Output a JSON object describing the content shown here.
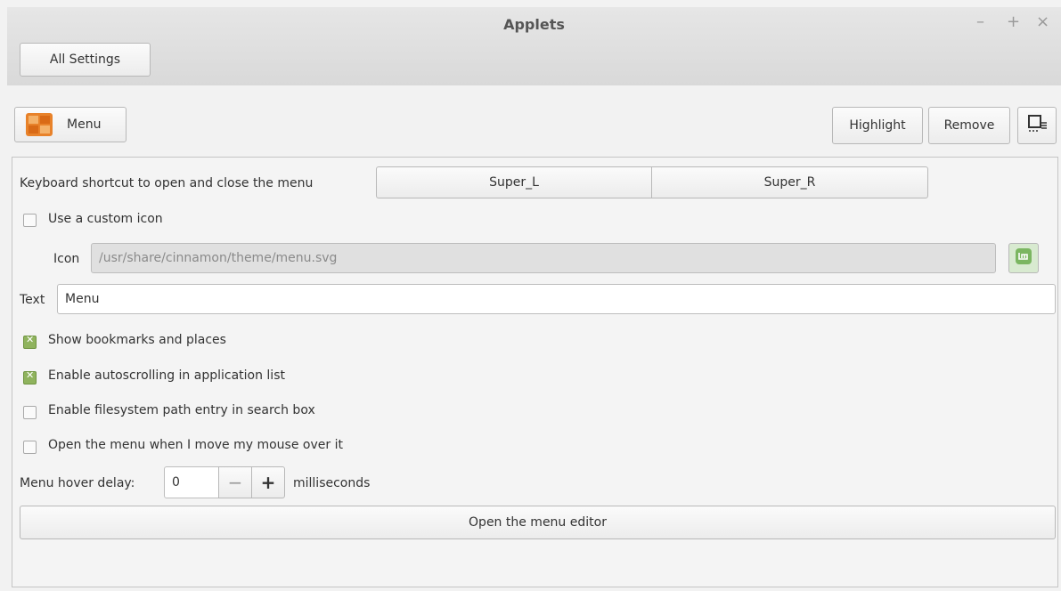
{
  "window": {
    "title": "Applets",
    "controls": [
      "–",
      "+",
      "×"
    ]
  },
  "toolbar": {
    "all_settings_label": "All Settings"
  },
  "applet_bar": {
    "applet_name": "Menu",
    "highlight_label": "Highlight",
    "remove_label": "Remove"
  },
  "settings": {
    "shortcut_label": "Keyboard shortcut to open and close the menu",
    "shortcut_primary": "Super_L",
    "shortcut_secondary": "Super_R",
    "custom_icon_label": "Use a custom icon",
    "custom_icon_checked": false,
    "icon_label": "Icon",
    "icon_path": "/usr/share/cinnamon/theme/menu.svg",
    "text_label": "Text",
    "text_value": "Menu",
    "show_bookmarks_label": "Show bookmarks and places",
    "show_bookmarks_checked": true,
    "autoscroll_label": "Enable autoscrolling in application list",
    "autoscroll_checked": true,
    "filesystem_label": "Enable filesystem path entry in search box",
    "filesystem_checked": false,
    "hover_open_label": "Open the menu when I move my mouse over it",
    "hover_open_checked": false,
    "hover_delay_label": "Menu hover delay:",
    "hover_delay_value": "0",
    "hover_delay_unit": "milliseconds",
    "menu_editor_label": "Open the menu editor"
  },
  "colors": {
    "check_on": "#8fb35d",
    "mint_green": "#7bb661",
    "applet_orange": "#e8822a"
  }
}
